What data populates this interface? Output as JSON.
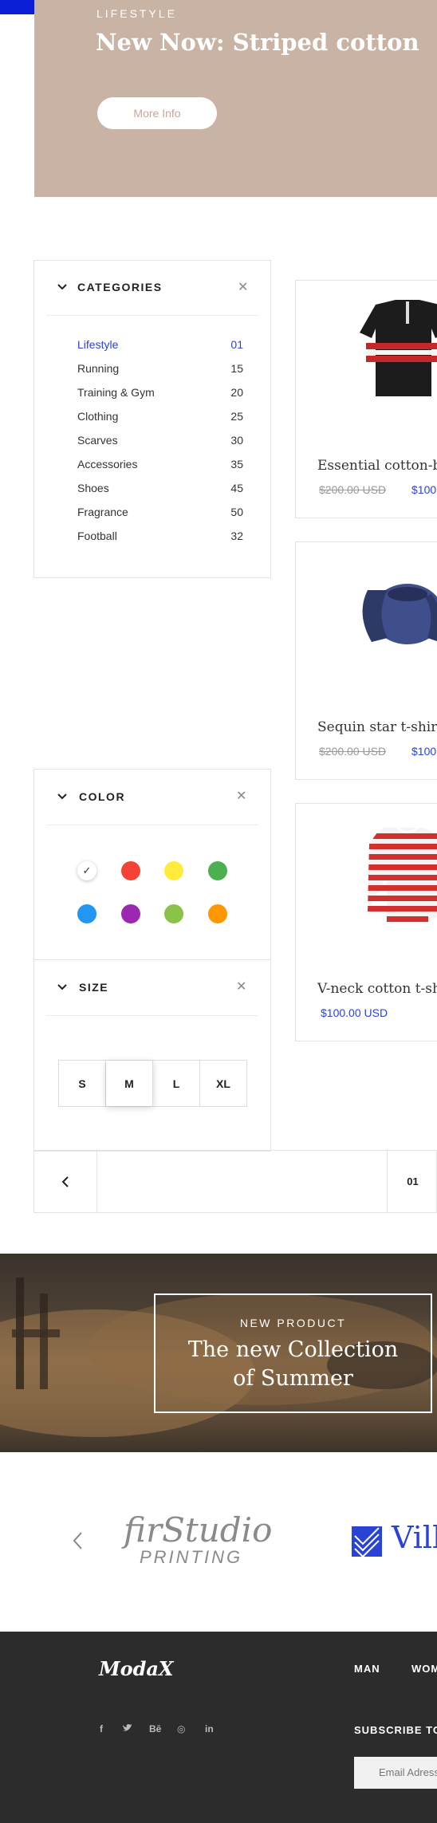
{
  "hero": {
    "kicker": "LIFESTYLE",
    "title": "New Now: Striped cotton",
    "button": "More Info"
  },
  "categories": {
    "title": "CATEGORIES",
    "items": [
      {
        "label": "Lifestyle",
        "count": "01",
        "active": true
      },
      {
        "label": "Running",
        "count": "15"
      },
      {
        "label": "Training & Gym",
        "count": "20"
      },
      {
        "label": "Clothing",
        "count": "25"
      },
      {
        "label": "Scarves",
        "count": "30"
      },
      {
        "label": "Accessories",
        "count": "35"
      },
      {
        "label": "Shoes",
        "count": "45"
      },
      {
        "label": "Fragrance",
        "count": "50"
      },
      {
        "label": "Football",
        "count": "32"
      }
    ]
  },
  "color_filter": {
    "title": "COLOR",
    "swatches": [
      "#ffffff",
      "#f44336",
      "#ffeb3b",
      "#4caf50",
      "#2196f3",
      "#9c27b0",
      "#8bc34a",
      "#ff9800"
    ],
    "selected": "#ffffff"
  },
  "size_filter": {
    "title": "SIZE",
    "sizes": [
      "S",
      "M",
      "L",
      "XL"
    ],
    "selected": "M"
  },
  "products": [
    {
      "name": "Essential cotton-bl",
      "old_price": "$200.00 USD",
      "price": "$100"
    },
    {
      "name": "Sequin star t-shirt",
      "old_price": "$200.00 USD",
      "price": "$100"
    },
    {
      "name": "V-neck cotton t-sh",
      "old_price": "",
      "price": "$100.00 USD"
    }
  ],
  "pagination": {
    "current": "01"
  },
  "collection": {
    "kicker": "NEW PRODUCT",
    "title_line1": "The new Collection",
    "title_line2": "of Summer"
  },
  "brands": {
    "brand1_name": "firStudio",
    "brand1_sub": "PRINTING",
    "brand2_name": "Vill"
  },
  "footer": {
    "logo": "ModaX",
    "nav": [
      "MAN",
      "WOM"
    ],
    "social": [
      "f",
      "t",
      "Bē",
      "◎",
      "in"
    ],
    "subscribe": "SUBSCRIBE TO",
    "email_placeholder": "Email Adress"
  },
  "colors": {
    "accent": "#2a43d6",
    "hero_bg": "#c9b3a5",
    "footer_bg": "#2c2c2c"
  }
}
